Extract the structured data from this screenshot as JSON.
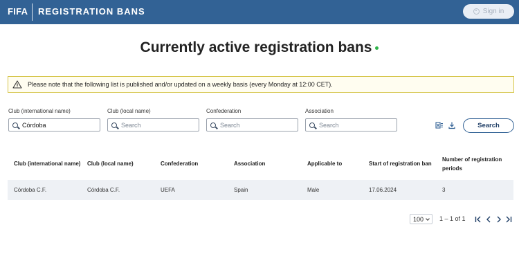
{
  "header": {
    "brand": "FIFA",
    "app_name": "REGISTRATION BANS",
    "signin_label": "Sign in"
  },
  "title": "Currently active registration bans",
  "notice": "Please note that the following list is published and/or updated on a weekly basis (every Monday at 12:00 CET).",
  "filters": {
    "club_international": {
      "label": "Club (international name)",
      "value": "Córdoba",
      "placeholder": "Search"
    },
    "club_local": {
      "label": "Club (local name)",
      "value": "",
      "placeholder": "Search"
    },
    "confederation": {
      "label": "Confederation",
      "value": "",
      "placeholder": "Search"
    },
    "association": {
      "label": "Association",
      "value": "",
      "placeholder": "Search"
    }
  },
  "search_button": "Search",
  "icons": {
    "excel": "excel-export-icon",
    "download": "download-icon",
    "warning": "warning-icon"
  },
  "table": {
    "headers": [
      "Club (international name)",
      "Club (local name)",
      "Confederation",
      "Association",
      "Applicable to",
      "Start of registration ban",
      "Number of registration periods"
    ],
    "rows": [
      [
        "Córdoba C.F.",
        "Córdoba C.F.",
        "UEFA",
        "Spain",
        "Male",
        "17.06.2024",
        "3"
      ]
    ]
  },
  "pagination": {
    "page_size": "100",
    "range": "1 – 1 of 1"
  },
  "colors": {
    "header_bg": "#326295",
    "live_dot": "#2fb34a",
    "notice_border": "#d6c54a"
  }
}
